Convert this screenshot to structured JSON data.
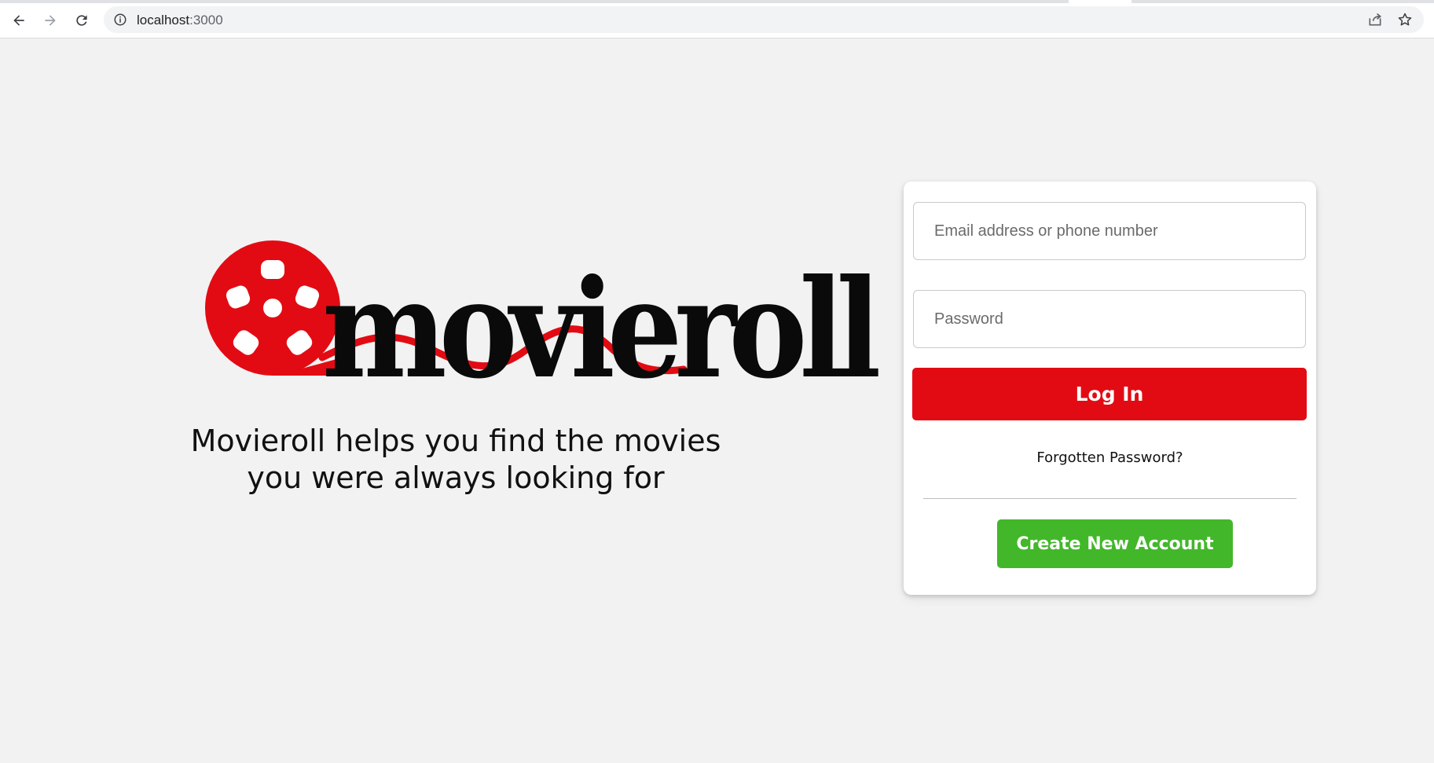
{
  "browser": {
    "url_host": "localhost",
    "url_port": ":3000"
  },
  "brand": {
    "logo_text": "movieroll",
    "tagline_line1": "Movieroll helps you find the movies",
    "tagline_line2": "you were always looking for",
    "logo_color": "#e30b13"
  },
  "login": {
    "email_placeholder": "Email address or phone number",
    "password_placeholder": "Password",
    "login_label": "Log In",
    "forgot_label": "Forgotten Password?",
    "create_label": "Create New Account"
  },
  "colors": {
    "primary": "#e30b13",
    "success": "#42b72a",
    "background": "#f2f2f2"
  }
}
